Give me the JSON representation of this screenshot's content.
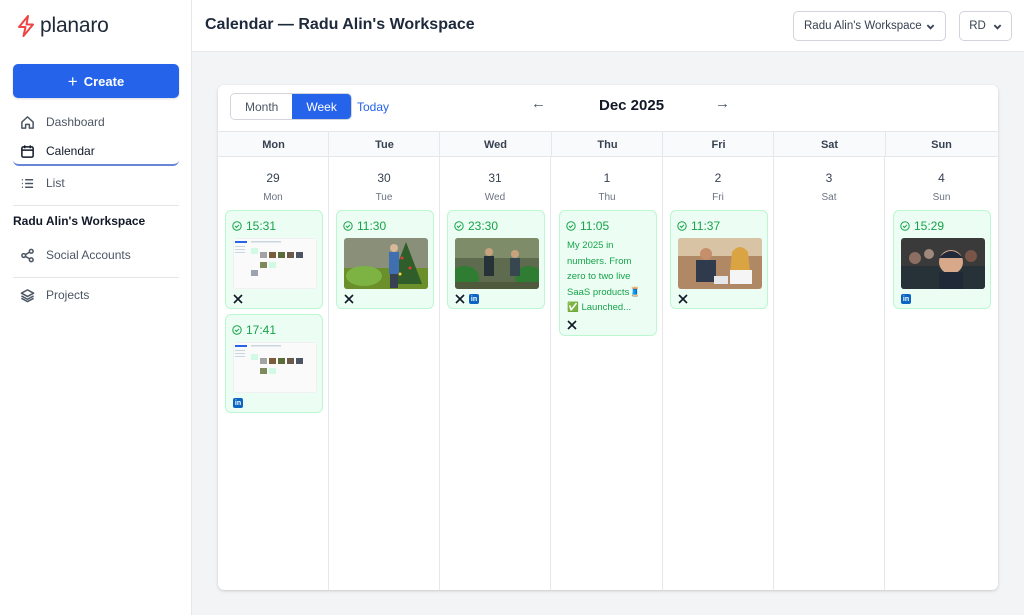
{
  "brand": {
    "name": "planaro",
    "accent": "#2563eb",
    "logo_color": "#ef4444"
  },
  "sidebar": {
    "create_label": "Create",
    "nav": [
      {
        "label": "Dashboard",
        "icon": "home-icon"
      },
      {
        "label": "Calendar",
        "icon": "calendar-icon",
        "active": true
      },
      {
        "label": "List",
        "icon": "list-icon"
      }
    ],
    "workspace_heading": "Radu Alin's Workspace",
    "workspace_nav": [
      {
        "label": "Social Accounts",
        "icon": "share-icon"
      },
      {
        "label": "Projects",
        "icon": "layers-icon"
      }
    ]
  },
  "header": {
    "title": "Calendar — Radu Alin's Workspace",
    "workspace_select": "Radu Alin's Workspace",
    "user_initials": "RD"
  },
  "calendar": {
    "view_month": "Month",
    "view_week": "Week",
    "active_view": "Week",
    "today_label": "Today",
    "prev_arrow": "←",
    "next_arrow": "→",
    "period_label": "Dec 2025",
    "days": [
      {
        "head": "Mon",
        "num": "29",
        "name": "Mon"
      },
      {
        "head": "Tue",
        "num": "30",
        "name": "Tue"
      },
      {
        "head": "Wed",
        "num": "31",
        "name": "Wed"
      },
      {
        "head": "Thu",
        "num": "1",
        "name": "Thu"
      },
      {
        "head": "Fri",
        "num": "2",
        "name": "Fri"
      },
      {
        "head": "Sat",
        "num": "3",
        "name": "Sat"
      },
      {
        "head": "Sun",
        "num": "4",
        "name": "Sun"
      }
    ],
    "posts": [
      {
        "day": 0,
        "time": "15:31",
        "media": "app-screenshot",
        "platforms": [
          "x"
        ]
      },
      {
        "day": 0,
        "time": "17:41",
        "media": "app-screenshot",
        "platforms": [
          "linkedin"
        ]
      },
      {
        "day": 1,
        "time": "11:30",
        "media": "photo-person-christmas-tree",
        "platforms": [
          "x"
        ]
      },
      {
        "day": 2,
        "time": "23:30",
        "media": "photo-people-plants",
        "platforms": [
          "x",
          "linkedin"
        ]
      },
      {
        "day": 3,
        "time": "11:05",
        "text": "My 2025 in numbers. From zero to two live SaaS products🧵 ✅ Launched...",
        "platforms": [
          "x"
        ]
      },
      {
        "day": 4,
        "time": "11:37",
        "media": "photo-meeting",
        "platforms": [
          "x"
        ]
      },
      {
        "day": 6,
        "time": "15:29",
        "media": "photo-selfie-crowd",
        "platforms": [
          "linkedin"
        ]
      }
    ]
  }
}
